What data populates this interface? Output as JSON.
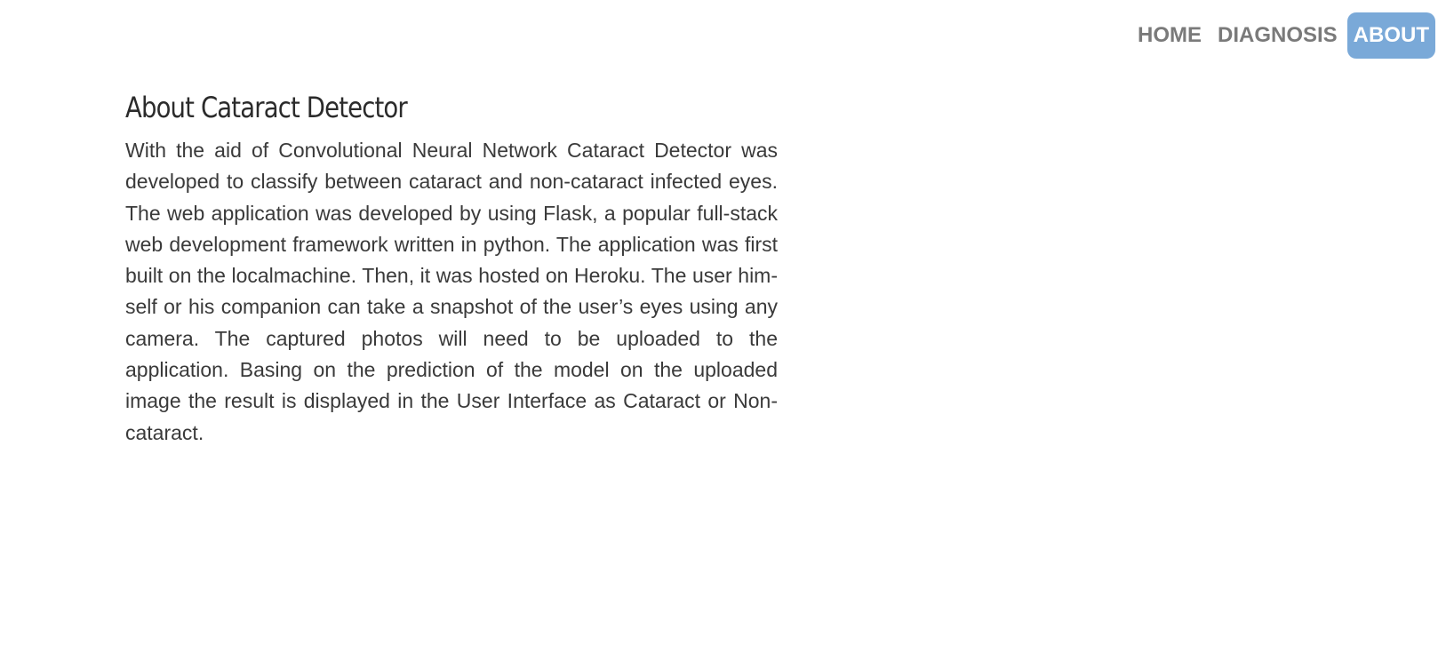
{
  "nav": {
    "items": [
      {
        "label": "HOME",
        "active": false
      },
      {
        "label": "DIAGNOSIS",
        "active": false
      },
      {
        "label": "ABOUT",
        "active": true
      }
    ],
    "active_color": "#7aa9d8",
    "text_color": "#7a7a7a"
  },
  "about": {
    "title": "About Cataract Detector",
    "body": "With the aid of Convolutional Neural Network Cataract Detector was developed to classify between cataract and non-cataract infected eyes. The web application was developed by using Flask, a popular full-stack web development framework written in python. The application was first built on the localmachine. Then, it was hosted on Heroku. The user him-self or his companion can take a snapshot of the user’s eyes using any camera. The captured photos will need to be uploaded to the application. Basing on the prediction of the model on the uploaded image the result is displayed in the User Interface as Cataract or Non-cataract."
  }
}
